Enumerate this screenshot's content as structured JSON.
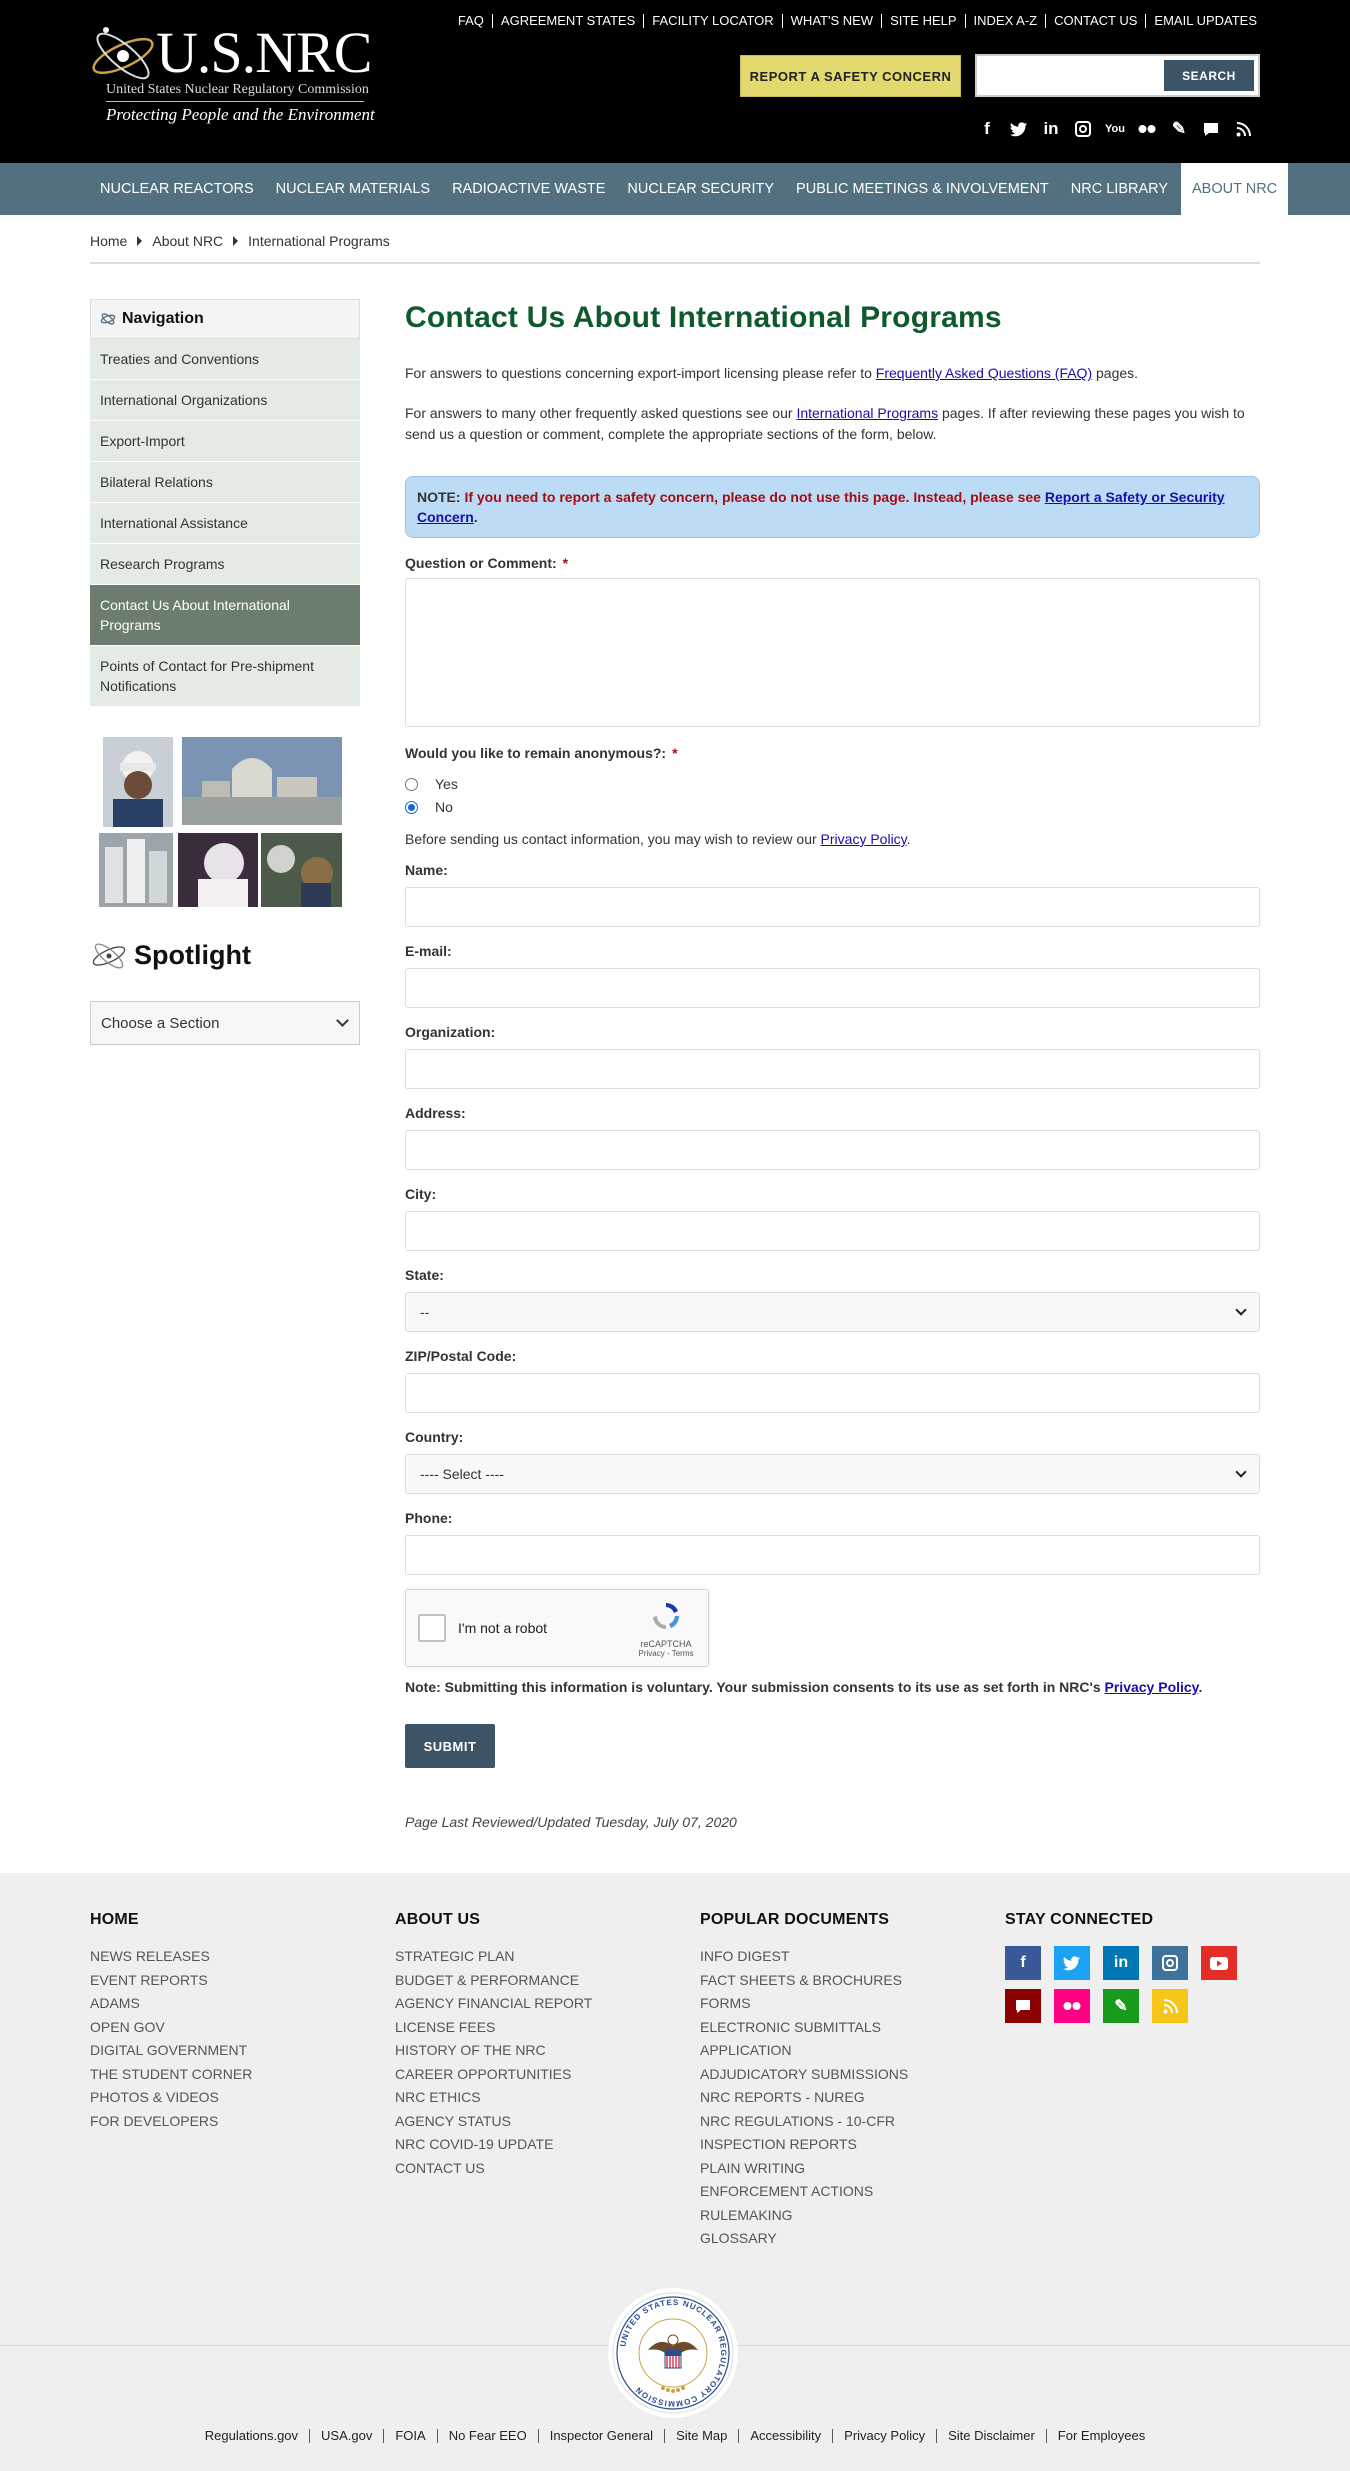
{
  "header": {
    "logo_text": "U.S.NRC",
    "logo_subtitle": "United States Nuclear Regulatory Commission",
    "logo_tagline": "Protecting People and the Environment",
    "top_links": [
      "FAQ",
      "AGREEMENT STATES",
      "FACILITY LOCATOR",
      "WHAT'S NEW",
      "SITE HELP",
      "INDEX A-Z",
      "CONTACT US",
      "EMAIL UPDATES"
    ],
    "report_button": "REPORT A SAFETY CONCERN",
    "search_placeholder": "",
    "search_button": "SEARCH",
    "social_icons": [
      "facebook-icon",
      "twitter-icon",
      "linkedin-icon",
      "instagram-icon",
      "youtube-icon",
      "flickr-icon",
      "blog-icon",
      "comment-icon",
      "rss-icon"
    ]
  },
  "nav": {
    "items": [
      "NUCLEAR REACTORS",
      "NUCLEAR MATERIALS",
      "RADIOACTIVE WASTE",
      "NUCLEAR SECURITY",
      "PUBLIC MEETINGS & INVOLVEMENT",
      "NRC LIBRARY",
      "ABOUT NRC"
    ],
    "active": "ABOUT NRC"
  },
  "breadcrumb": [
    "Home",
    "About NRC",
    "International Programs"
  ],
  "sidebar": {
    "title": "Navigation",
    "items": [
      "Treaties and Conventions",
      "International Organizations",
      "Export-Import",
      "Bilateral Relations",
      "International Assistance",
      "Research Programs",
      "Contact Us About International Programs",
      "Points of Contact for Pre-shipment Notifications"
    ],
    "active_index": 6,
    "spotlight_title": "Spotlight",
    "spotlight_select": "Choose a Section"
  },
  "main": {
    "title": "Contact Us About International Programs",
    "p1_before": "For answers to questions concerning export-import licensing please refer to ",
    "p1_link": "Frequently Asked Questions (FAQ)",
    "p1_after": " pages.",
    "p2_before": "For answers to many other frequently asked questions see our ",
    "p2_link": "International Programs",
    "p2_after": " pages. If after reviewing these pages you wish to send us a question or comment, complete the appropriate sections of the form, below.",
    "note_label": "NOTE:",
    "note_red": " If you need to report a safety concern, please do not use this page. Instead, please see ",
    "note_link": "Report a Safety or Security Concern",
    "note_end": ".",
    "question_label": "Question or Comment:",
    "anon_label": "Would you like to remain anonymous?:",
    "anon_yes": "Yes",
    "anon_no": "No",
    "anon_selected": "No",
    "privacy_before": "Before sending us contact information, you may wish to review our ",
    "privacy_link": "Privacy Policy",
    "privacy_after": ".",
    "required_mark": "*",
    "fields": {
      "name": "Name:",
      "email": "E-mail:",
      "organization": "Organization:",
      "address": "Address:",
      "city": "City:",
      "state": "State:",
      "state_value": "--",
      "zip": "ZIP/Postal Code:",
      "country": "Country:",
      "country_value": "---- Select ----",
      "phone": "Phone:"
    },
    "captcha_text": "I'm not a robot",
    "captcha_brand": "reCAPTCHA",
    "captcha_terms": "Privacy - Terms",
    "voluntary_before": "Note: Submitting this information is voluntary. Your submission consents to its use as set forth in NRC's ",
    "voluntary_link": "Privacy Policy",
    "voluntary_after": ".",
    "submit": "SUBMIT",
    "updated": "Page Last Reviewed/Updated Tuesday, July 07, 2020"
  },
  "footer": {
    "home": {
      "title": "HOME",
      "links": [
        "NEWS RELEASES",
        "EVENT REPORTS",
        "ADAMS",
        "OPEN GOV",
        "DIGITAL GOVERNMENT",
        "THE STUDENT CORNER",
        "PHOTOS & VIDEOS",
        "FOR DEVELOPERS"
      ]
    },
    "about": {
      "title": "ABOUT US",
      "links": [
        "STRATEGIC PLAN",
        "BUDGET & PERFORMANCE",
        "AGENCY FINANCIAL REPORT",
        "LICENSE FEES",
        "HISTORY OF THE NRC",
        "CAREER OPPORTUNITIES",
        "NRC ETHICS",
        "AGENCY STATUS",
        "NRC COVID-19 UPDATE",
        "CONTACT US"
      ]
    },
    "docs": {
      "title": "POPULAR DOCUMENTS",
      "links": [
        "INFO DIGEST",
        "FACT SHEETS & BROCHURES",
        "FORMS",
        "ELECTRONIC SUBMITTALS",
        "APPLICATION",
        "ADJUDICATORY SUBMISSIONS",
        "NRC REPORTS - NUREG",
        "NRC REGULATIONS - 10-CFR",
        "INSPECTION REPORTS",
        "PLAIN WRITING",
        "ENFORCEMENT ACTIONS",
        "RULEMAKING",
        "GLOSSARY"
      ]
    },
    "stay": {
      "title": "STAY CONNECTED"
    },
    "social_colors": {
      "facebook": "#3b5998",
      "twitter": "#1da1f2",
      "linkedin": "#0077b5",
      "instagram": "#3f729b",
      "youtube": "#e52d27",
      "blog": "#8b0000",
      "flickr": "#ff0084",
      "edit": "#189a1c",
      "rss": "#f5c518"
    },
    "seal_text": "UNITED STATES NUCLEAR REGULATORY COMMISSION",
    "bottom_links": [
      "Regulations.gov",
      "USA.gov",
      "FOIA",
      "No Fear EEO",
      "Inspector General",
      "Site Map",
      "Accessibility",
      "Privacy Policy",
      "Site Disclaimer",
      "For Employees"
    ]
  }
}
